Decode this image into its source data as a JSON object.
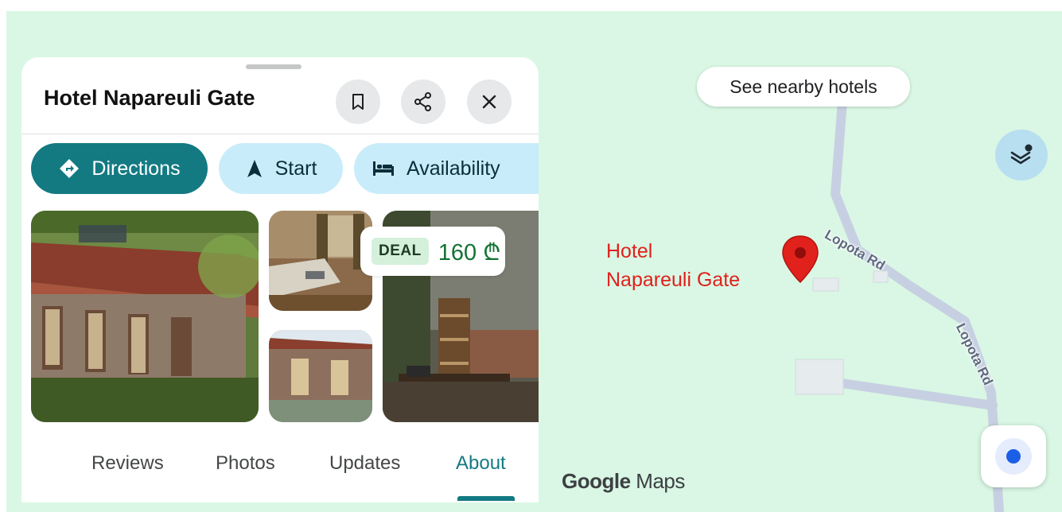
{
  "place": {
    "title": "Hotel Napareuli Gate",
    "map_label_line1": "Hotel",
    "map_label_line2": "Napareuli Gate"
  },
  "header_actions": [
    {
      "icon": "bookmark-icon"
    },
    {
      "icon": "share-icon"
    },
    {
      "icon": "close-icon"
    }
  ],
  "action_chips": {
    "directions": {
      "label": "Directions",
      "icon": "directions-icon"
    },
    "start": {
      "label": "Start",
      "icon": "navigation-arrow-icon"
    },
    "availability": {
      "label": "Availability",
      "icon": "bed-icon"
    }
  },
  "deal": {
    "badge": "DEAL",
    "price": "160 ₾"
  },
  "tabs": [
    {
      "label": "Reviews"
    },
    {
      "label": "Photos"
    },
    {
      "label": "Updates"
    },
    {
      "label": "About",
      "active": true
    }
  ],
  "map": {
    "nearby_chip": "See nearby hotels",
    "road_name_1": "Lopota Rd",
    "road_name_2": "Lopota Rd",
    "brand_google": "Google",
    "brand_maps": "Maps",
    "layers_icon": "layers-icon",
    "locate_icon": "my-location-icon"
  },
  "colors": {
    "accent": "#137a82",
    "chip_tonal": "#c9ecfa",
    "map_background": "#d9f7e4",
    "pin": "#e0211c",
    "deal_price": "#137333"
  }
}
